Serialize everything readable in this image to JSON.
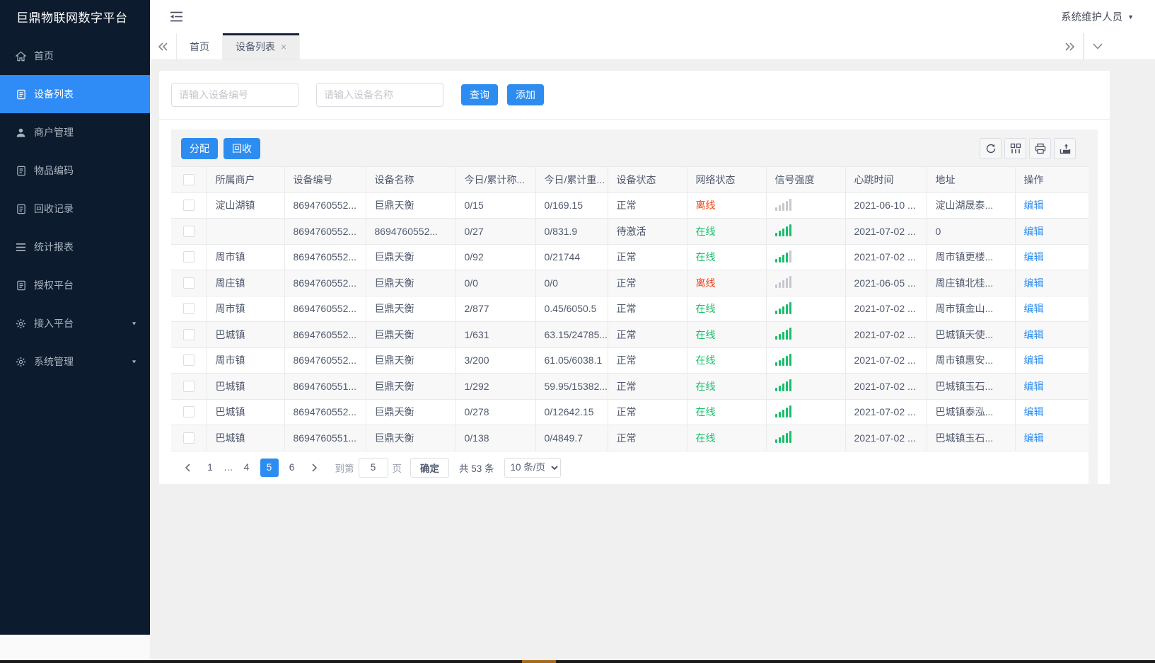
{
  "app": {
    "title": "巨鼎物联网数字平台",
    "user_name": "系统维护人员"
  },
  "colors": {
    "primary": "#2d8cf0",
    "online": "#19be6b",
    "offline": "#ed4014",
    "signal_gray": "#c5c8ce",
    "sidebar_bg": "#0d1b2e"
  },
  "sidebar": {
    "items": [
      {
        "label": "首页",
        "icon": "home-icon",
        "active": false,
        "expandable": false
      },
      {
        "label": "设备列表",
        "icon": "document-icon",
        "active": true,
        "expandable": false
      },
      {
        "label": "商户管理",
        "icon": "user-icon",
        "active": false,
        "expandable": false
      },
      {
        "label": "物品编码",
        "icon": "document-icon",
        "active": false,
        "expandable": false
      },
      {
        "label": "回收记录",
        "icon": "document-icon",
        "active": false,
        "expandable": false
      },
      {
        "label": "统计报表",
        "icon": "list-icon",
        "active": false,
        "expandable": false
      },
      {
        "label": "授权平台",
        "icon": "document-icon",
        "active": false,
        "expandable": false
      },
      {
        "label": "接入平台",
        "icon": "gear-icon",
        "active": false,
        "expandable": true
      },
      {
        "label": "系统管理",
        "icon": "gear-icon",
        "active": false,
        "expandable": true
      }
    ]
  },
  "tabs": [
    {
      "label": "首页",
      "active": false,
      "closable": false
    },
    {
      "label": "设备列表",
      "active": true,
      "closable": true
    }
  ],
  "search": {
    "device_no_placeholder": "请输入设备编号",
    "device_name_placeholder": "请输入设备名称",
    "query_label": "查询",
    "add_label": "添加"
  },
  "toolbar": {
    "assign_label": "分配",
    "recycle_label": "回收",
    "icons": [
      "refresh-icon",
      "columns-icon",
      "print-icon",
      "export-icon"
    ]
  },
  "table": {
    "headers": [
      "所属商户",
      "设备编号",
      "设备名称",
      "今日/累计称...",
      "今日/累计重...",
      "设备状态",
      "网络状态",
      "信号强度",
      "心跳时间",
      "地址",
      "操作"
    ],
    "edit_label": "编辑",
    "rows": [
      {
        "merchant": "淀山湖镇",
        "device_no": "8694760552...",
        "device_name": "巨鼎天衡",
        "today_count": "0/15",
        "today_weight": "0/169.15",
        "device_status": "正常",
        "network_status": "离线",
        "online": false,
        "signal_level": 0,
        "heartbeat": "2021-06-10 ...",
        "address": "淀山湖晟泰..."
      },
      {
        "merchant": "",
        "device_no": "8694760552...",
        "device_name": "8694760552...",
        "today_count": "0/27",
        "today_weight": "0/831.9",
        "device_status": "待激活",
        "network_status": "在线",
        "online": true,
        "signal_level": 5,
        "heartbeat": "2021-07-02 ...",
        "address": "0"
      },
      {
        "merchant": "周市镇",
        "device_no": "8694760552...",
        "device_name": "巨鼎天衡",
        "today_count": "0/92",
        "today_weight": "0/21744",
        "device_status": "正常",
        "network_status": "在线",
        "online": true,
        "signal_level": 4,
        "heartbeat": "2021-07-02 ...",
        "address": "周市镇更楼..."
      },
      {
        "merchant": "周庄镇",
        "device_no": "8694760552...",
        "device_name": "巨鼎天衡",
        "today_count": "0/0",
        "today_weight": "0/0",
        "device_status": "正常",
        "network_status": "离线",
        "online": false,
        "signal_level": 0,
        "heartbeat": "2021-06-05 ...",
        "address": "周庄镇北桂..."
      },
      {
        "merchant": "周市镇",
        "device_no": "8694760552...",
        "device_name": "巨鼎天衡",
        "today_count": "2/877",
        "today_weight": "0.45/6050.5",
        "device_status": "正常",
        "network_status": "在线",
        "online": true,
        "signal_level": 5,
        "heartbeat": "2021-07-02 ...",
        "address": "周市镇金山..."
      },
      {
        "merchant": "巴城镇",
        "device_no": "8694760552...",
        "device_name": "巨鼎天衡",
        "today_count": "1/631",
        "today_weight": "63.15/24785...",
        "device_status": "正常",
        "network_status": "在线",
        "online": true,
        "signal_level": 5,
        "heartbeat": "2021-07-02 ...",
        "address": "巴城镇天使..."
      },
      {
        "merchant": "周市镇",
        "device_no": "8694760552...",
        "device_name": "巨鼎天衡",
        "today_count": "3/200",
        "today_weight": "61.05/6038.1",
        "device_status": "正常",
        "network_status": "在线",
        "online": true,
        "signal_level": 5,
        "heartbeat": "2021-07-02 ...",
        "address": "周市镇惠安..."
      },
      {
        "merchant": "巴城镇",
        "device_no": "8694760551...",
        "device_name": "巨鼎天衡",
        "today_count": "1/292",
        "today_weight": "59.95/15382...",
        "device_status": "正常",
        "network_status": "在线",
        "online": true,
        "signal_level": 5,
        "heartbeat": "2021-07-02 ...",
        "address": "巴城镇玉石..."
      },
      {
        "merchant": "巴城镇",
        "device_no": "8694760552...",
        "device_name": "巨鼎天衡",
        "today_count": "0/278",
        "today_weight": "0/12642.15",
        "device_status": "正常",
        "network_status": "在线",
        "online": true,
        "signal_level": 5,
        "heartbeat": "2021-07-02 ...",
        "address": "巴城镇泰泓..."
      },
      {
        "merchant": "巴城镇",
        "device_no": "8694760551...",
        "device_name": "巨鼎天衡",
        "today_count": "0/138",
        "today_weight": "0/4849.7",
        "device_status": "正常",
        "network_status": "在线",
        "online": true,
        "signal_level": 5,
        "heartbeat": "2021-07-02 ...",
        "address": "巴城镇玉石..."
      }
    ]
  },
  "pagination": {
    "pages": [
      "1",
      "...",
      "4",
      "5",
      "6"
    ],
    "active_page": "5",
    "goto_label": "到第",
    "goto_value": "5",
    "unit_label": "页",
    "confirm_label": "确定",
    "total_label": "共 53 条",
    "page_size_value": "10 条/页"
  }
}
